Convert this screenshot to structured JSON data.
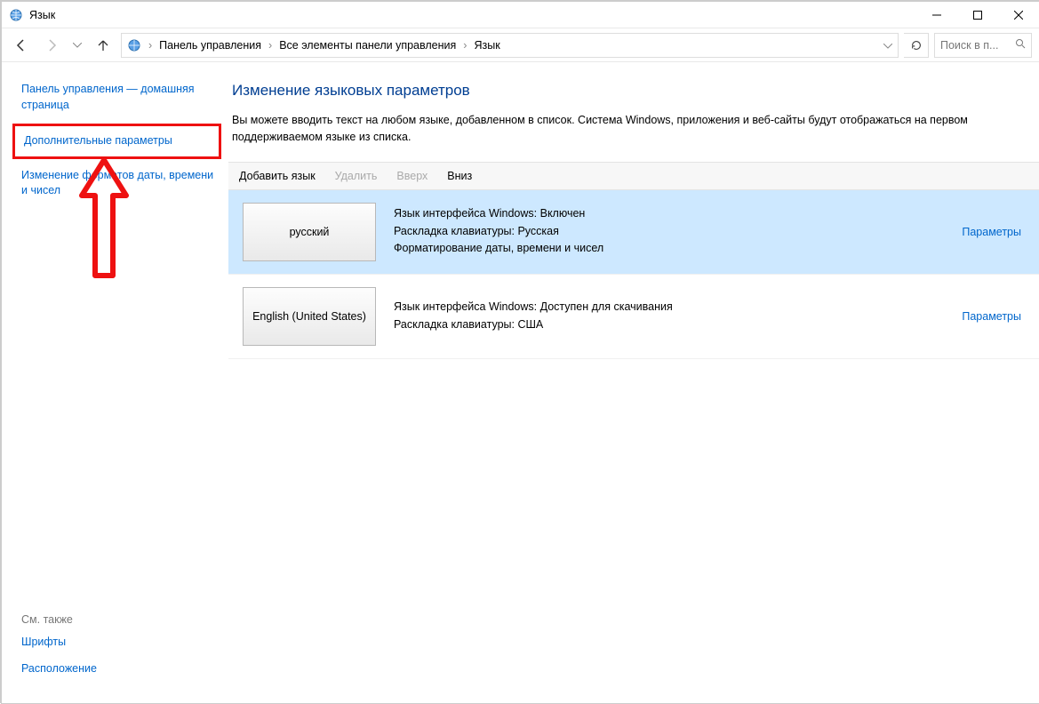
{
  "window": {
    "title": "Язык"
  },
  "breadcrumb": {
    "items": [
      "Панель управления",
      "Все элементы панели управления",
      "Язык"
    ]
  },
  "search": {
    "placeholder": "Поиск в п..."
  },
  "sidebar": {
    "home": "Панель управления — домашняя страница",
    "advanced": "Дополнительные параметры",
    "formats": "Изменение форматов даты, времени и чисел",
    "seealso_header": "См. также",
    "seealso": [
      "Шрифты",
      "Расположение"
    ]
  },
  "main": {
    "heading": "Изменение языковых параметров",
    "description": "Вы можете вводить текст на любом языке, добавленном в список. Система Windows, приложения и веб-сайты будут отображаться на первом поддерживаемом языке из списка."
  },
  "toolbar": {
    "add": "Добавить язык",
    "remove": "Удалить",
    "up": "Вверх",
    "down": "Вниз"
  },
  "languages": [
    {
      "name": "русский",
      "details": [
        "Язык интерфейса Windows: Включен",
        "Раскладка клавиатуры: Русская",
        "Форматирование даты, времени и чисел"
      ],
      "options": "Параметры",
      "selected": true
    },
    {
      "name": "English (United States)",
      "details": [
        "Язык интерфейса Windows: Доступен для скачивания",
        "Раскладка клавиатуры: США"
      ],
      "options": "Параметры",
      "selected": false
    }
  ]
}
